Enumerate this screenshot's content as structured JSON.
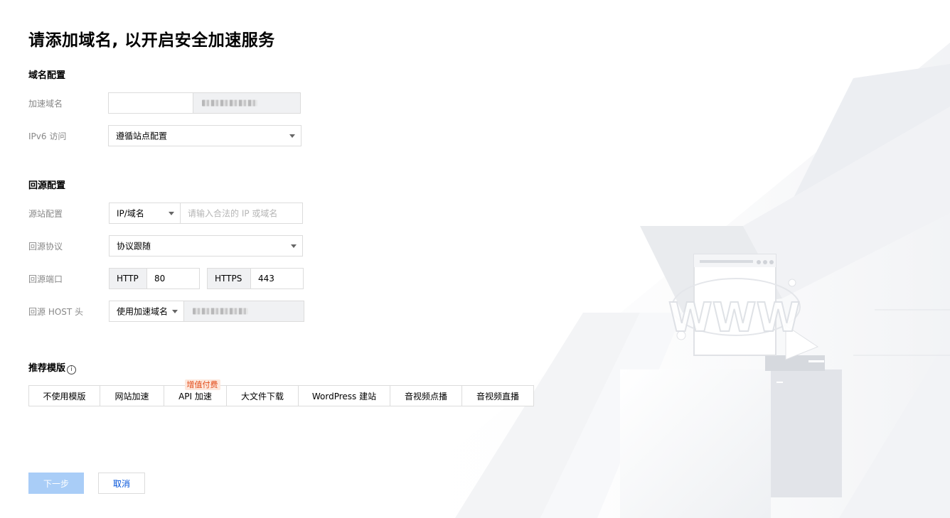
{
  "page_title": "请添加域名, 以开启安全加速服务",
  "domain_config": {
    "section_title": "域名配置",
    "accel_domain_label": "加速域名",
    "accel_domain_value": "",
    "ipv6_label": "IPv6 访问",
    "ipv6_value": "遵循站点配置"
  },
  "origin_config": {
    "section_title": "回源配置",
    "origin_site_label": "源站配置",
    "origin_type_value": "IP/域名",
    "origin_input_placeholder": "请输入合法的 IP 或域名",
    "protocol_label": "回源协议",
    "protocol_value": "协议跟随",
    "port_label": "回源端口",
    "http_label": "HTTP",
    "http_port": "80",
    "https_label": "HTTPS",
    "https_port": "443",
    "host_label": "回源 HOST 头",
    "host_type_value": "使用加速域名"
  },
  "templates": {
    "section_title": "推荐模版",
    "info_icon": "i",
    "items": [
      {
        "label": "不使用模版"
      },
      {
        "label": "网站加速"
      },
      {
        "label": "API 加速",
        "badge": "增值付费"
      },
      {
        "label": "大文件下载"
      },
      {
        "label": "WordPress 建站"
      },
      {
        "label": "音视频点播"
      },
      {
        "label": "音视频直播"
      }
    ]
  },
  "actions": {
    "next_label": "下一步",
    "cancel_label": "取消"
  },
  "illustration": {
    "text": "WWW"
  }
}
